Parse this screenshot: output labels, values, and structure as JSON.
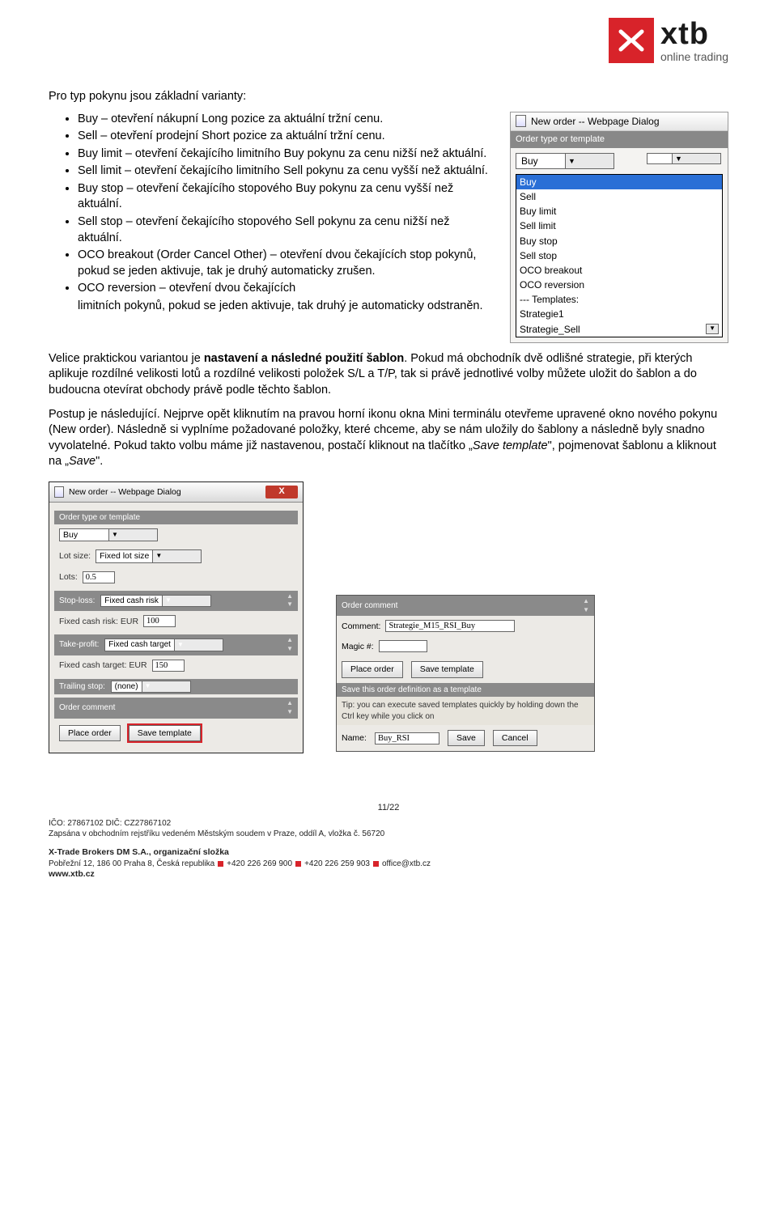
{
  "logo": {
    "brand": "xtb",
    "sub": "online trading"
  },
  "intro": "Pro typ pokynu jsou základní varianty:",
  "bullets": [
    "Buy – otevření nákupní Long pozice za aktuální tržní cenu.",
    "Sell – otevření prodejní Short pozice za aktuální tržní cenu.",
    "Buy limit – otevření čekajícího limitního Buy pokynu za cenu nižší než aktuální.",
    "Sell limit – otevření čekajícího limitního Sell pokynu za cenu vyšší než aktuální.",
    "Buy stop – otevření čekajícího stopového Buy pokynu za cenu vyšší než aktuální.",
    "Sell stop – otevření čekajícího stopového Sell pokynu za cenu nižší než aktuální.",
    "OCO breakout (Order Cancel Other) – otevření dvou čekajících stop pokynů, pokud se jeden aktivuje, tak je druhý automaticky zrušen."
  ],
  "bullet_last_pre": "OCO reversion – otevření dvou čekajících",
  "bullet_last_cont": "limitních pokynů, pokud se jeden aktivuje, tak druhý je automaticky odstraněn.",
  "shot1": {
    "title": "New order -- Webpage Dialog",
    "section": "Order type or template",
    "selected": "Buy",
    "options": [
      "Buy",
      "Sell",
      "Buy limit",
      "Sell limit",
      "Buy stop",
      "Sell stop",
      "OCO breakout",
      "OCO reversion",
      "--- Templates:",
      "Strategie1",
      "Strategie_Sell"
    ]
  },
  "para2_pre": "Velice praktickou variantou je ",
  "para2_bold": "nastavení a následné použití šablon",
  "para2_post": ". Pokud má obchodník dvě odlišné strategie, při kterých aplikuje rozdílné velikosti lotů a rozdílné velikosti položek S/L a T/P, tak si právě jednotlivé volby můžete uložit do šablon a do budoucna otevírat obchody právě podle těchto šablon.",
  "para3_a": "Postup je následující. Nejprve opět kliknutím na pravou horní ikonu okna Mini terminálu otevřeme upravené okno nového pokynu (New order). Následně si vyplníme požadované položky, které chceme, aby se nám uložily do šablony a následně byly snadno vyvolatelné. Pokud takto volbu máme již nastavenou, postačí kliknout na tlačítko „",
  "para3_i1": "Save template",
  "para3_b": "\", pojmenovat šablonu a kliknout na „",
  "para3_i2": "Save",
  "para3_c": "\".",
  "shot2": {
    "title": "New order -- Webpage Dialog",
    "sect_order": "Order type or template",
    "buy": "Buy",
    "lot_size_lbl": "Lot size:",
    "lot_size_val": "Fixed lot size",
    "lots_lbl": "Lots:",
    "lots_val": "0.5",
    "sl_sect": "Stop-loss:",
    "sl_sel": "Fixed cash risk",
    "sl_row_lbl": "Fixed cash risk: EUR",
    "sl_val": "100",
    "tp_sect": "Take-profit:",
    "tp_sel": "Fixed cash target",
    "tp_row_lbl": "Fixed cash target: EUR",
    "tp_val": "150",
    "trail_sect": "Trailing stop:",
    "trail_sel": "(none)",
    "comment_sect": "Order comment",
    "btn_place": "Place order",
    "btn_save": "Save template"
  },
  "shot3": {
    "comment_sect": "Order comment",
    "comment_lbl": "Comment:",
    "comment_val": "Strategie_M15_RSI_Buy",
    "magic_lbl": "Magic #:",
    "magic_val": "",
    "btn_place": "Place order",
    "btn_save": "Save template",
    "save_sect": "Save this order definition as a template",
    "tip": "Tip: you can execute saved templates quickly by holding down the Ctrl key while you click on",
    "name_lbl": "Name:",
    "name_val": "Buy_RSI",
    "btn_s": "Save",
    "btn_c": "Cancel"
  },
  "footer": {
    "pg": "11/22",
    "l1": "IČO: 27867102 DIČ: CZ27867102",
    "l2": "Zapsána v obchodním rejstříku vedeném Městským soudem v Praze, oddíl A, vložka č. 56720",
    "l3": "X-Trade Brokers DM S.A., organizační složka",
    "addr": "Pobřežní 12, 186 00 Praha 8, Česká republika",
    "ph1": "+420 226 269 900",
    "ph2": "+420 226 259 903",
    "mail": "office@xtb.cz",
    "web": "www.xtb.cz"
  }
}
